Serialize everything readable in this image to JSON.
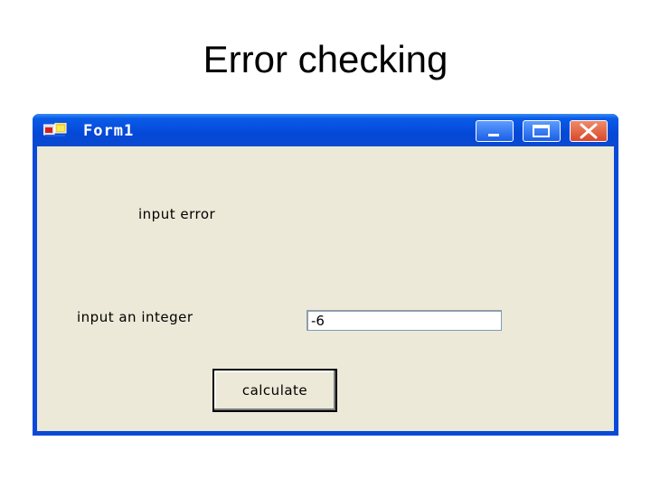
{
  "slide": {
    "title": "Error checking"
  },
  "window": {
    "title": "Form1",
    "icon": "app-form-icon",
    "controls": {
      "minimize_icon": "minimize-icon",
      "maximize_icon": "maximize-icon",
      "close_icon": "close-icon"
    }
  },
  "form": {
    "error_label": "input error",
    "prompt_label": "input an integer",
    "input_value": "-6",
    "calculate_label": "calculate"
  },
  "colors": {
    "titlebar": "#0548d8",
    "client_bg": "#ece9d8",
    "close_button": "#d7482a"
  }
}
